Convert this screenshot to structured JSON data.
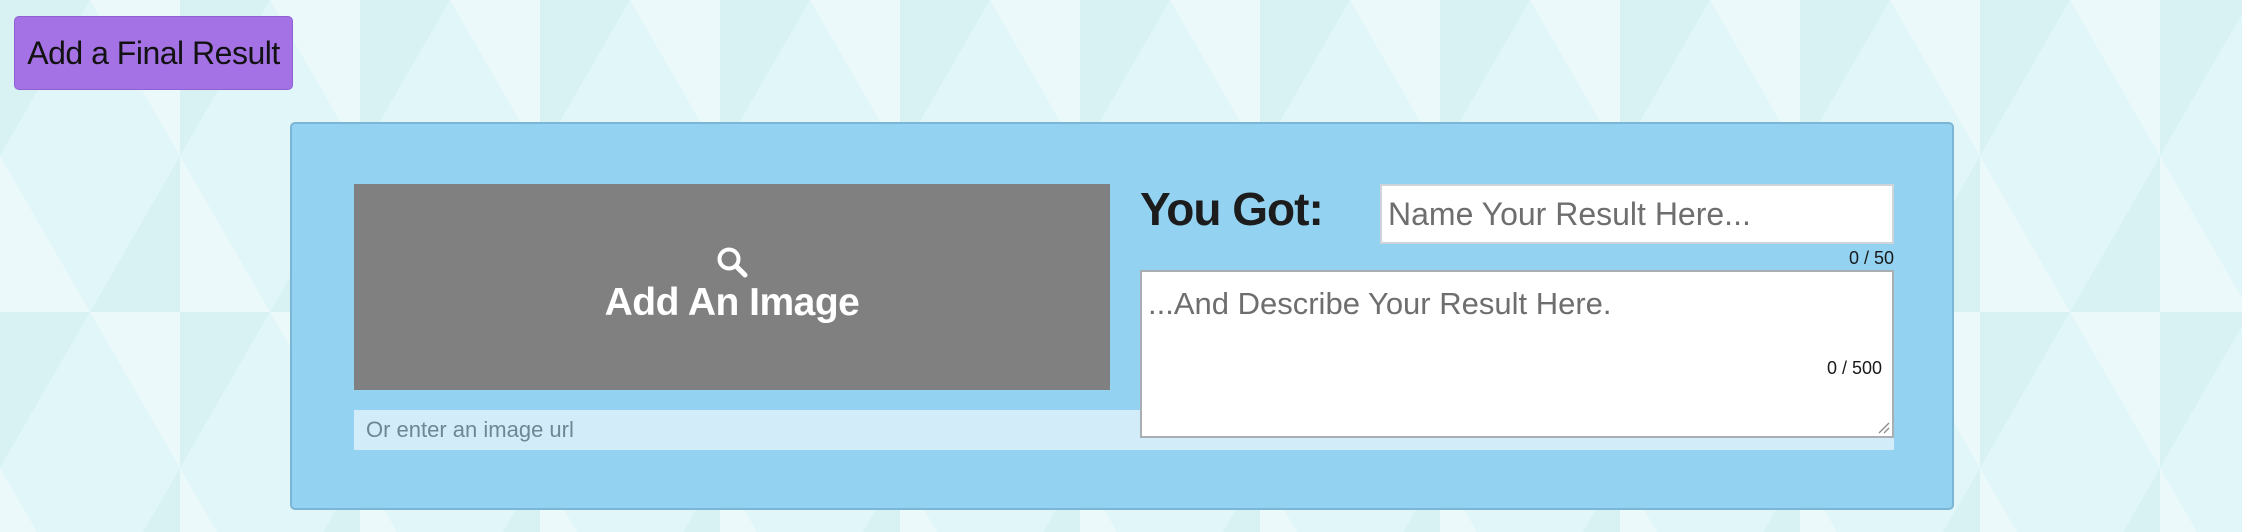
{
  "header": {
    "add_final_result_label": "Add a Final Result"
  },
  "result_card": {
    "image_upload": {
      "icon": "search-icon",
      "label": "Add An Image"
    },
    "image_url": {
      "placeholder": "Or enter an image url",
      "value": ""
    },
    "you_got_label": "You Got:",
    "result_name": {
      "placeholder": "Name Your Result Here...",
      "value": "",
      "counter": "0 / 50"
    },
    "result_description": {
      "placeholder": "...And Describe Your Result Here.",
      "value": "",
      "counter": "0 / 500"
    }
  },
  "colors": {
    "button_purple": "#a472e4",
    "panel_blue": "#93d2f0",
    "image_box_gray": "#808080",
    "page_background": "#e1f6f8"
  }
}
